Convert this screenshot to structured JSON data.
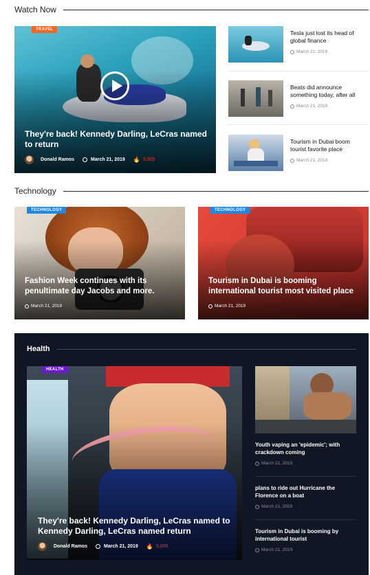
{
  "watch_now": {
    "heading": "Watch Now",
    "featured": {
      "badge": "TRAVEL",
      "badge_color": "#f26522",
      "title": "They're back! Kennedy Darling, LeCras named to return",
      "author": "Donald Ramos",
      "date": "March 21, 2019",
      "views": "3,005"
    },
    "side": [
      {
        "title": "Tesla just lost its head of global finance",
        "date": "March 21, 2019"
      },
      {
        "title": "Beats did announce something today, after all",
        "date": "March 21, 2019"
      },
      {
        "title": "Tourism in Dubai boom tourist favorite place",
        "date": "March 21, 2019"
      }
    ]
  },
  "technology": {
    "heading": "Technology",
    "badge_color": "#1e88e5",
    "cards": [
      {
        "badge": "TECHNOLOGY",
        "title": "Fashion Week continues with its penultimate day Jacobs and more.",
        "date": "March 21, 2019"
      },
      {
        "badge": "TECHNOLOGY",
        "title": "Tourism in Dubai is booming international tourist most visited place",
        "date": "March 21, 2019"
      }
    ]
  },
  "health": {
    "heading": "Health",
    "featured": {
      "badge": "HEALTH",
      "badge_color": "#6a1bd1",
      "title": "They're back! Kennedy Darling, LeCras named to Kennedy Darling, LeCras named return",
      "author": "Donald Ramos",
      "date": "March 21, 2019",
      "views": "3,005"
    },
    "side": [
      {
        "title": "Youth vaping an 'epidemic'; with crackdown coming",
        "date": "March 21, 2019"
      },
      {
        "title": "plans to ride out Hurricane the Florence on a boat",
        "date": "March 21, 2019"
      },
      {
        "title": "Tourism in Dubai is booming by international tourist",
        "date": "March 21, 2019"
      }
    ]
  }
}
